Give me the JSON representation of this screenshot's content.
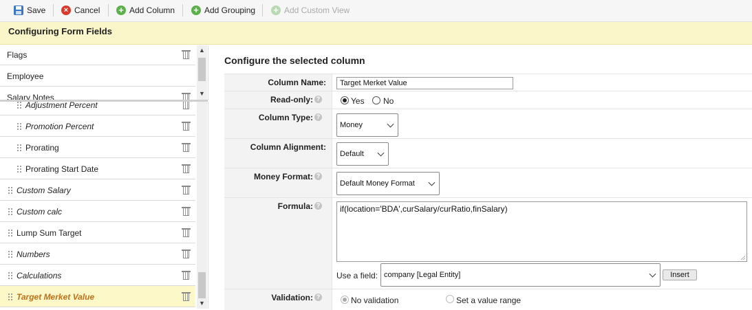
{
  "toolbar": {
    "save_label": "Save",
    "cancel_label": "Cancel",
    "add_column_label": "Add Column",
    "add_grouping_label": "Add Grouping",
    "add_custom_view_label": "Add Custom View"
  },
  "header": {
    "title": "Configuring Form Fields"
  },
  "top_panel": {
    "items": [
      {
        "label": "Flags"
      },
      {
        "label": "Employee"
      },
      {
        "label": "Salary Notes"
      }
    ]
  },
  "field_list": {
    "items": [
      {
        "label": "Adjustment Percent"
      },
      {
        "label": "Promotion Percent"
      },
      {
        "label": "Prorating"
      },
      {
        "label": "Prorating Start Date"
      },
      {
        "label": "Custom Salary"
      },
      {
        "label": "Custom calc"
      },
      {
        "label": "Lump Sum Target"
      },
      {
        "label": "Numbers"
      },
      {
        "label": "Calculations"
      },
      {
        "label": "Target Merket Value",
        "selected": true
      }
    ]
  },
  "config": {
    "title": "Configure the selected column",
    "column_name_label": "Column Name:",
    "column_name_value": "Target Merket Value",
    "readonly_label": "Read-only:",
    "readonly_yes": "Yes",
    "readonly_no": "No",
    "readonly_value": "Yes",
    "column_type_label": "Column Type:",
    "column_type_value": "Money",
    "alignment_label": "Column Alignment:",
    "alignment_value": "Default",
    "money_format_label": "Money Format:",
    "money_format_value": "Default Money Format",
    "formula_label": "Formula:",
    "formula_value": "if(location='BDA',curSalary/curRatio,finSalary)",
    "use_field_label": "Use a field:",
    "use_field_value": "company [Legal Entity]",
    "insert_label": "Insert",
    "validation_label": "Validation:",
    "validation_none": "No validation",
    "validation_range": "Set a value range",
    "validation_value": "No validation"
  },
  "icons": {
    "save": "save-icon",
    "cancel": "cancel-icon",
    "add": "add-icon",
    "help": "help-icon",
    "trash": "trash-icon",
    "drag": "drag-handle-icon"
  }
}
